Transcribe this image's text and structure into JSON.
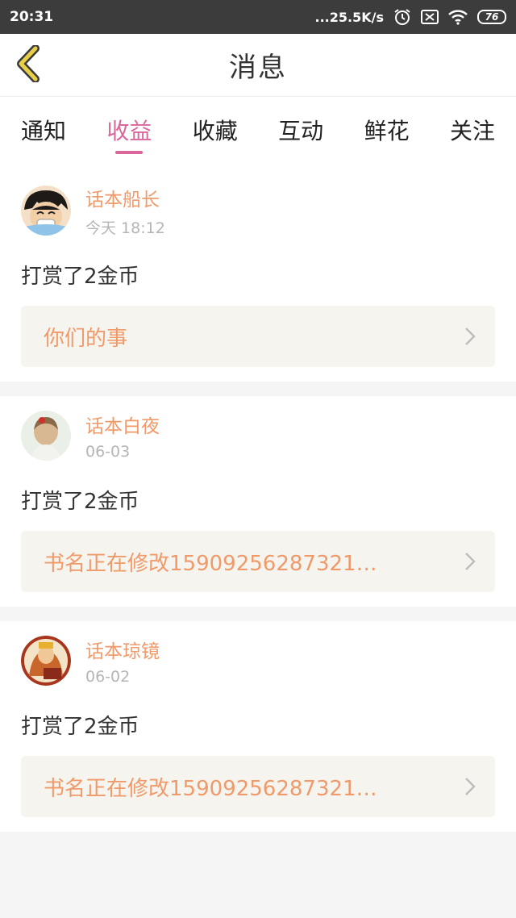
{
  "status_bar": {
    "time": "20:31",
    "net_speed": "...25.5K/s",
    "battery": "76",
    "icons": [
      "alarm-icon",
      "sim-off-icon",
      "wifi-icon",
      "battery-icon"
    ]
  },
  "header": {
    "title": "消息",
    "back_icon": "chevron-left-icon"
  },
  "tabs": [
    {
      "label": "通知"
    },
    {
      "label": "收益"
    },
    {
      "label": "收藏"
    },
    {
      "label": "互动"
    },
    {
      "label": "鲜花"
    },
    {
      "label": "关注"
    }
  ],
  "active_tab": "收益",
  "colors": {
    "accent_pink": "#d9679b",
    "name_orange": "#f09a6a",
    "card_bg": "#f5f4ef",
    "back_icon_yellow": "#e8cf4a"
  },
  "messages": [
    {
      "username": "话本船长",
      "time": "今天 18:12",
      "content": "打赏了2金币",
      "book": "你们的事"
    },
    {
      "username": "话本白夜",
      "time": "06-03",
      "content": "打赏了2金币",
      "book": "书名正在修改15909256287321…"
    },
    {
      "username": "话本琼镜",
      "time": "06-02",
      "content": "打赏了2金币",
      "book": "书名正在修改15909256287321…"
    }
  ]
}
